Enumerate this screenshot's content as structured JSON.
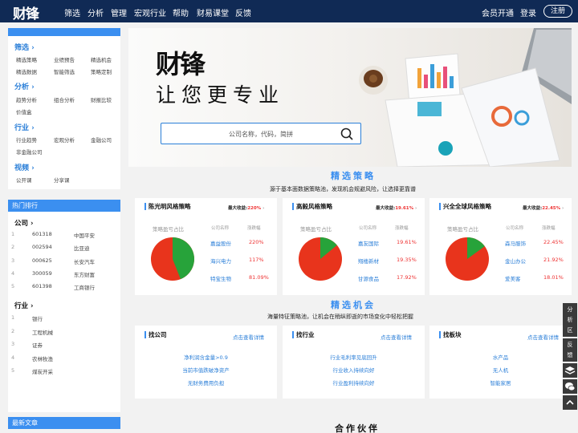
{
  "nav": {
    "logo": "财锋",
    "items": [
      "筛选",
      "分析",
      "管理",
      "宏观行业",
      "帮助",
      "财易课堂",
      "反馈"
    ],
    "membership": "会员开通",
    "login": "登录",
    "register": "注册"
  },
  "sidebar": {
    "sections": [
      {
        "title": "筛选",
        "links": [
          "精选策略",
          "业绩预告",
          "精选机会",
          "精选数据",
          "智能筛选",
          "策略定制"
        ]
      },
      {
        "title": "分析",
        "links": [
          "趋势分析",
          "组合分析",
          "财报比较",
          "价值盒"
        ]
      },
      {
        "title": "行业",
        "links": [
          "行业趋势",
          "宏观分析",
          "金融公司",
          "非金融公司"
        ]
      },
      {
        "title": "视频",
        "links": [
          "公开课",
          "分享课"
        ]
      }
    ]
  },
  "hot": {
    "title": "热门排行",
    "company_title": "公司",
    "companies": [
      {
        "rank": "1",
        "code": "601318",
        "name": "中国平安"
      },
      {
        "rank": "2",
        "code": "002594",
        "name": "比亚迪"
      },
      {
        "rank": "3",
        "code": "000625",
        "name": "长安汽车"
      },
      {
        "rank": "4",
        "code": "300059",
        "name": "东方财富"
      },
      {
        "rank": "5",
        "code": "601398",
        "name": "工商银行"
      }
    ],
    "industry_title": "行业",
    "industries": [
      {
        "rank": "1",
        "name": "银行"
      },
      {
        "rank": "2",
        "name": "工程机械"
      },
      {
        "rank": "3",
        "name": "证券"
      },
      {
        "rank": "4",
        "name": "农林牧渔"
      },
      {
        "rank": "5",
        "name": "煤炭开采"
      }
    ]
  },
  "latest": {
    "title": "最新文章"
  },
  "banner": {
    "brand": "财锋",
    "slogan": "让您更专业",
    "search_placeholder": "公司名称，代码，简拼"
  },
  "strategy": {
    "title": "精选策略",
    "subtitle": "源于基本面数据策略池，发现机会规避风险，让选择更靠谱",
    "pie_title": "策略盈亏占比",
    "col_name": "公司名称",
    "col_change": "涨跌幅",
    "max_label": "最大收益:",
    "colors": {
      "red": "#e8341c",
      "green": "#27a33a"
    },
    "cards": [
      {
        "title": "陈光明风格策略",
        "max": "220%",
        "win_ratio": 0.44,
        "rows": [
          {
            "name": "嘉益股份",
            "change": "220%"
          },
          {
            "name": "海兴电力",
            "change": "117%"
          },
          {
            "name": "特宝生物",
            "change": "81.09%"
          }
        ]
      },
      {
        "title": "高毅风格策略",
        "max": "19.61%",
        "win_ratio": 0.14,
        "rows": [
          {
            "name": "嘉友国际",
            "change": "19.61%"
          },
          {
            "name": "翔楼新材",
            "change": "19.35%"
          },
          {
            "name": "甘源食品",
            "change": "17.92%"
          }
        ]
      },
      {
        "title": "兴全全球风格策略",
        "max": "22.45%",
        "win_ratio": 0.15,
        "rows": [
          {
            "name": "森马服饰",
            "change": "22.45%"
          },
          {
            "name": "金山办公",
            "change": "21.92%"
          },
          {
            "name": "爱美客",
            "change": "18.01%"
          }
        ]
      }
    ]
  },
  "opportunity": {
    "title": "精选机会",
    "subtitle": "海量特征策略池，让机会在稍纵即逝的市场变化中轻松把握",
    "more": "点击查看详情",
    "cards": [
      {
        "title": "找公司",
        "items": [
          "净利润含金量>0.9",
          "当前市值跌破净资产",
          "无财务费用负担"
        ]
      },
      {
        "title": "找行业",
        "items": [
          "行业毛利率见底回升",
          "行业收入持续向好",
          "行业盈利持续向好"
        ]
      },
      {
        "title": "找板块",
        "items": [
          "水产品",
          "无人机",
          "智能家居"
        ]
      }
    ]
  },
  "partners": {
    "title": "合作伙伴"
  },
  "right_tools": {
    "analysis": "分析区",
    "feedback": "反馈"
  }
}
